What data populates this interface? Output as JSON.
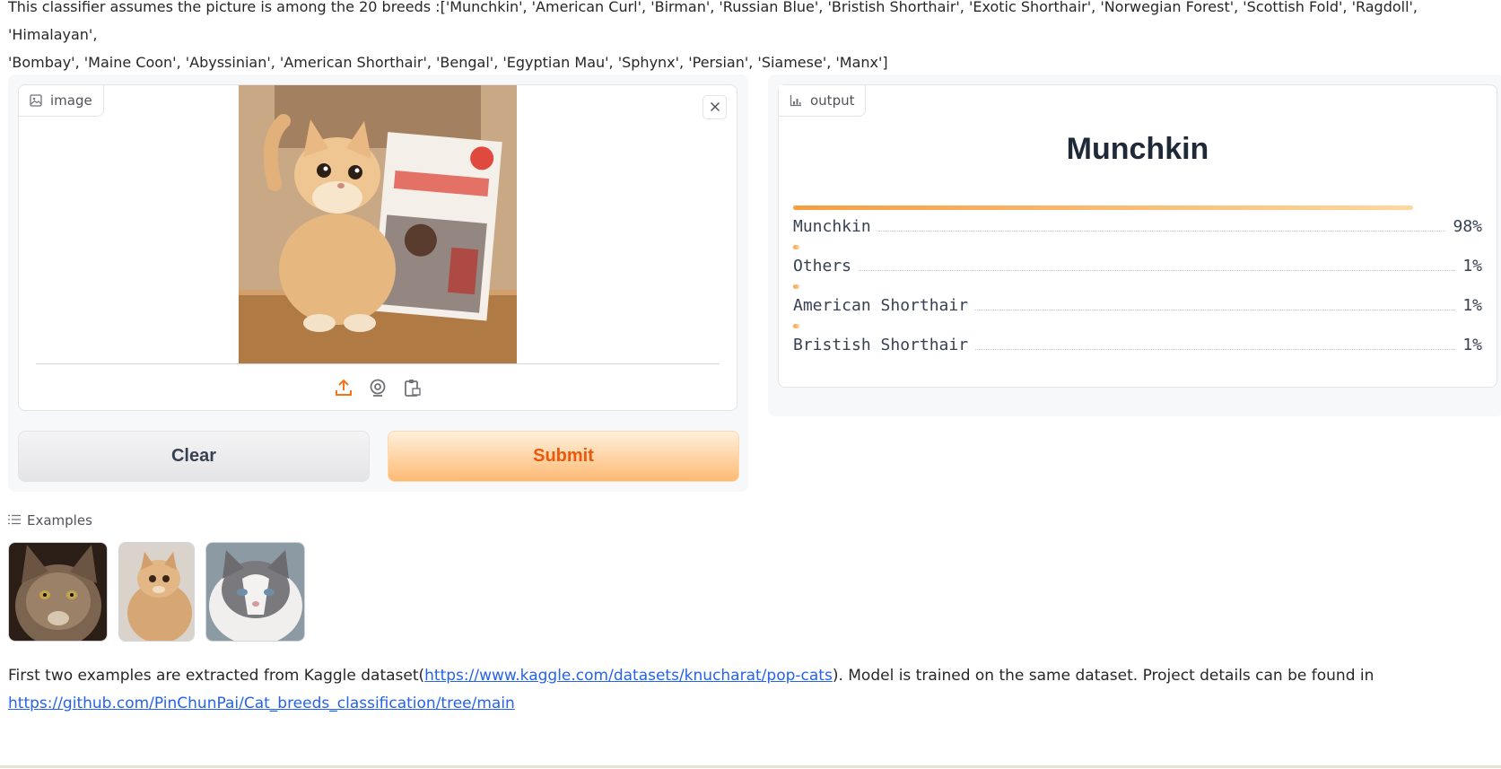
{
  "intro": {
    "line1": "This classifier assumes the picture is among the 20 breeds :['Munchkin', 'American Curl', 'Birman', 'Russian Blue', 'Bristish Shorthair', 'Exotic Shorthair', 'Norwegian Forest', 'Scottish Fold', 'Ragdoll', 'Himalayan',",
    "line2": "'Bombay', 'Maine Coon', 'Abyssinian', 'American Shorthair', 'Bengal', 'Egyptian Mau', 'Sphynx', 'Persian', 'Siamese', 'Manx']"
  },
  "input": {
    "label": "image",
    "label_icon": "image-icon",
    "close_icon": "close-icon",
    "sources": [
      "upload-icon",
      "webcam-icon",
      "clipboard-icon"
    ]
  },
  "buttons": {
    "clear": "Clear",
    "submit": "Submit"
  },
  "output": {
    "label": "output",
    "label_icon": "bar-chart-icon",
    "top_label": "Munchkin",
    "confidences": [
      {
        "name": "Munchkin",
        "pct": "98%",
        "value": 0.98
      },
      {
        "name": "Others",
        "pct": "1%",
        "value": 0.01
      },
      {
        "name": "American Shorthair",
        "pct": "1%",
        "value": 0.01
      },
      {
        "name": "Bristish Shorthair",
        "pct": "1%",
        "value": 0.01
      }
    ]
  },
  "examples": {
    "label": "Examples",
    "label_icon": "list-icon",
    "count": 3
  },
  "footer": {
    "text1": "First two examples are extracted from Kaggle dataset(",
    "link1": "https://www.kaggle.com/datasets/knucharat/pop-cats",
    "text2": "). Model is trained on the same dataset. Project details can be found in",
    "link2": "https://github.com/PinChunPai/Cat_breeds_classification/tree/main"
  },
  "colors": {
    "accent": "#f97316",
    "submit_text": "#ea580c",
    "link": "#2563eb"
  }
}
